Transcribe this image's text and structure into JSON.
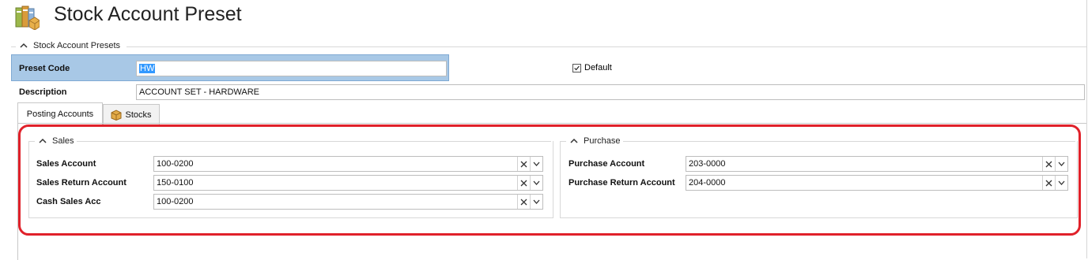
{
  "header": {
    "title": "Stock Account Preset",
    "icon": "stock-folders-icon"
  },
  "presets_group": {
    "label": "Stock Account Presets"
  },
  "preset_code": {
    "label": "Preset Code",
    "value": "HW"
  },
  "default": {
    "label": "Default",
    "checked": true
  },
  "description": {
    "label": "Description",
    "value": "ACCOUNT SET - HARDWARE"
  },
  "tabs": [
    {
      "label": "Posting Accounts",
      "active": true
    },
    {
      "label": "Stocks",
      "icon": "package-icon",
      "active": false
    }
  ],
  "sales": {
    "label": "Sales",
    "fields": [
      {
        "label": "Sales Account",
        "value": "100-0200"
      },
      {
        "label": "Sales Return Account",
        "value": "150-0100"
      },
      {
        "label": "Cash Sales Acc",
        "value": "100-0200"
      }
    ]
  },
  "purchase": {
    "label": "Purchase",
    "fields": [
      {
        "label": "Purchase Account",
        "value": "203-0000"
      },
      {
        "label": "Purchase Return Account",
        "value": "204-0000"
      }
    ]
  },
  "colors": {
    "highlight_outline": "#e0212a",
    "preset_bg": "#a8c8e6",
    "selection": "#3399ff"
  }
}
